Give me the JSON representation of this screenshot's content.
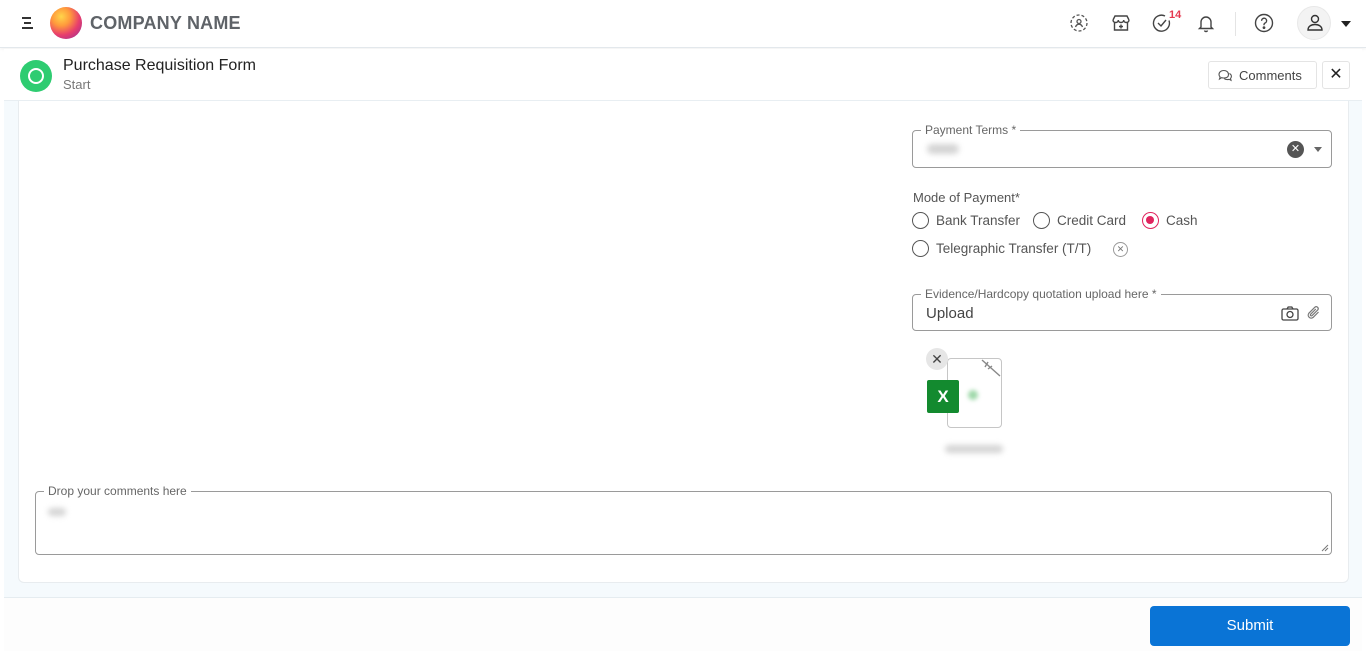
{
  "header": {
    "company_name": "COMPANY NAME",
    "icons": [
      "menu-icon",
      "logo",
      "user-settings-icon",
      "store-add-icon",
      "tasks-check-icon",
      "bell-icon",
      "help-icon",
      "user-avatar-icon"
    ],
    "tasks_badge": "14"
  },
  "form_header": {
    "title": "Purchase Requisition Form",
    "status": "Start",
    "comments_label": "Comments",
    "close_label": "✕"
  },
  "form": {
    "payment_terms": {
      "label": "Payment Terms *",
      "value_redacted": true
    },
    "mode_of_payment": {
      "label": "Mode of Payment*",
      "options": [
        {
          "label": "Bank Transfer",
          "selected": false
        },
        {
          "label": "Credit Card",
          "selected": false
        },
        {
          "label": "Cash",
          "selected": true
        },
        {
          "label": "Telegraphic Transfer (T/T)",
          "selected": false
        }
      ],
      "clear_label": "✕"
    },
    "evidence_upload": {
      "label": "Evidence/Hardcopy quotation upload here   *",
      "value": "Upload",
      "attachments": [
        {
          "type": "excel",
          "type_label": "X",
          "name_redacted": true
        }
      ],
      "remove_label": "✕"
    },
    "comments": {
      "label": "Drop your comments here",
      "value_redacted": true
    }
  },
  "footer": {
    "submit_label": "Submit"
  },
  "colors": {
    "accent": "#0a74d6",
    "status_green": "#2ecc71",
    "radio_selected": "#e0245e",
    "badge": "#e53950",
    "excel_green": "#138a2f"
  }
}
